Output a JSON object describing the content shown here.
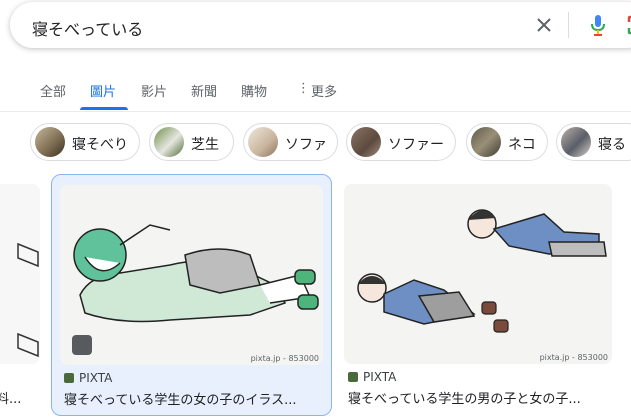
{
  "search": {
    "query": "寝そべっている"
  },
  "tabs": [
    {
      "label": "全部"
    },
    {
      "label": "圖片"
    },
    {
      "label": "影片"
    },
    {
      "label": "新聞"
    },
    {
      "label": "購物"
    },
    {
      "label": "更多"
    }
  ],
  "chips": [
    {
      "label": "寝そべり"
    },
    {
      "label": "芝生"
    },
    {
      "label": "ソファ"
    },
    {
      "label": "ソファー"
    },
    {
      "label": "ネコ"
    },
    {
      "label": "寝る"
    }
  ],
  "results": [
    {
      "source": "PIXTA",
      "title": "寝そべっている学生の女の子のイラス...",
      "credit": "pixta.jp - 853000"
    },
    {
      "source": "PIXTA",
      "title": "寝そべっている学生の男の子と女の子...",
      "credit": "pixta.jp - 853000"
    }
  ],
  "partial_left": {
    "title": "料..."
  },
  "colors": {
    "accent": "#1a73e8",
    "selected_bg": "#e8f0fe"
  }
}
